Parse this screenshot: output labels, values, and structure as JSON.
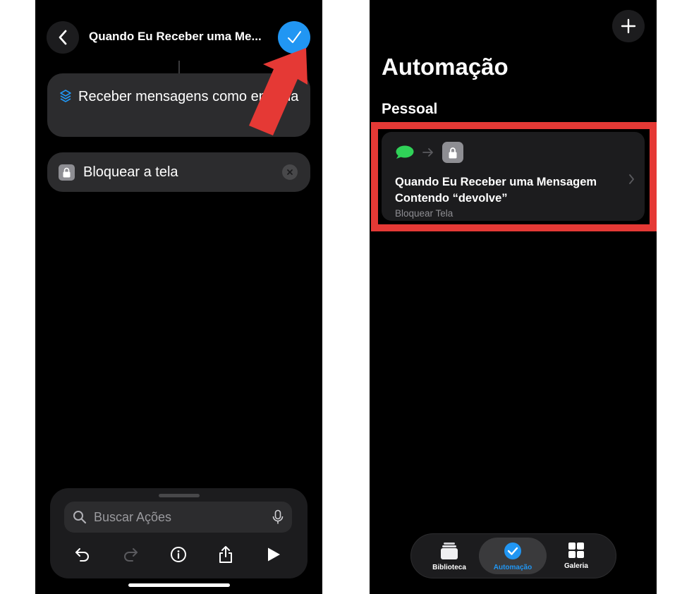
{
  "left_screen": {
    "nav_title": "Quando Eu Receber uma Me...",
    "actions": [
      {
        "icon": "shortcut-stack-icon",
        "label": "Receber mensagens como entrada"
      },
      {
        "icon": "lock-icon",
        "label": "Bloquear a tela"
      }
    ],
    "search_placeholder": "Buscar Ações",
    "colors": {
      "accent": "#2196f3",
      "annotation_arrow": "#e53935"
    }
  },
  "right_screen": {
    "title": "Automação",
    "section": "Pessoal",
    "automation": {
      "trigger_icon": "message-bubble-icon",
      "action_icon": "lock-icon",
      "title": "Quando Eu Receber uma Mensagem Contendo “devolve”",
      "subtitle": "Bloquear Tela"
    },
    "tabs": [
      {
        "label": "Biblioteca",
        "icon": "library-icon",
        "active": false
      },
      {
        "label": "Automação",
        "icon": "automation-icon",
        "active": true
      },
      {
        "label": "Galeria",
        "icon": "gallery-grid-icon",
        "active": false
      }
    ],
    "colors": {
      "highlight_box": "#e53935",
      "message_green": "#30d158",
      "active_tab": "#2196f3"
    }
  }
}
